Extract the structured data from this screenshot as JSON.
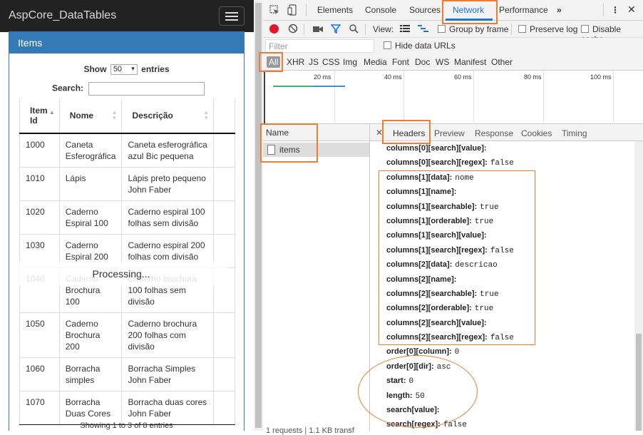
{
  "page": {
    "brand": "AspCore_DataTables",
    "panel_title": "Items",
    "length_prefix": "Show",
    "length_value": "50",
    "length_suffix": "entries",
    "search_label": "Search:",
    "columns": [
      {
        "line1": "Item",
        "line2": "Id"
      },
      {
        "line1": "Nome",
        "line2": ""
      },
      {
        "line1": "Descrição",
        "line2": ""
      }
    ],
    "rows": [
      {
        "id": "1000",
        "nome": "Caneta Esferográfica",
        "desc": "Caneta esferográfica azul Bic pequena"
      },
      {
        "id": "1010",
        "nome": "Lápis",
        "desc": "Lápis preto pequeno John Faber"
      },
      {
        "id": "1020",
        "nome": "Caderno Espiral 100",
        "desc": "Caderno espiral 100 folhas sem divisão"
      },
      {
        "id": "1030",
        "nome": "Caderno Espiral 200",
        "desc": "Caderno espiral 200 folhas com divisão"
      },
      {
        "id": "1040",
        "nome": "Caderno Brochura 100",
        "desc": "Caderno brochura 100 folhas sem divisão"
      },
      {
        "id": "1050",
        "nome": "Caderno Brochura 200",
        "desc": "Caderno brochura 200 folhas com divisão"
      },
      {
        "id": "1060",
        "nome": "Borracha simples",
        "desc": "Borracha Simples John Faber"
      },
      {
        "id": "1070",
        "nome": "Borracha Duas Cores",
        "desc": "Borracha duas cores John Faber"
      }
    ],
    "processing": "Processing...",
    "info": "Showing 1 to 3 of 8 entries"
  },
  "devtools": {
    "panels": [
      "Elements",
      "Console",
      "Sources",
      "Network",
      "Performance",
      "»"
    ],
    "active_panel": "Network",
    "toolbar": {
      "view_label": "View:",
      "group_by_frame": "Group by frame",
      "preserve_log": "Preserve log",
      "disable_cache": "Disable cache"
    },
    "filter_placeholder": "Filter",
    "hide_data_urls": "Hide data URLs",
    "types": [
      "All",
      "XHR",
      "JS",
      "CSS",
      "Img",
      "Media",
      "Font",
      "Doc",
      "WS",
      "Manifest",
      "Other"
    ],
    "timeline_ticks": [
      "20 ms",
      "40 ms",
      "60 ms",
      "80 ms",
      "100 ms"
    ],
    "name_header": "Name",
    "request_name": "items",
    "summary": "1 requests | 1.1 KB transf",
    "detail_tabs": [
      "Headers",
      "Preview",
      "Response",
      "Cookies",
      "Timing"
    ],
    "form_data": [
      {
        "k": "columns[0][search][value]:",
        "v": ""
      },
      {
        "k": "columns[0][search][regex]:",
        "v": "false"
      },
      {
        "k": "columns[1][data]:",
        "v": "nome"
      },
      {
        "k": "columns[1][name]:",
        "v": ""
      },
      {
        "k": "columns[1][searchable]:",
        "v": "true"
      },
      {
        "k": "columns[1][orderable]:",
        "v": "true"
      },
      {
        "k": "columns[1][search][value]:",
        "v": ""
      },
      {
        "k": "columns[1][search][regex]:",
        "v": "false"
      },
      {
        "k": "columns[2][data]:",
        "v": "descricao"
      },
      {
        "k": "columns[2][name]:",
        "v": ""
      },
      {
        "k": "columns[2][searchable]:",
        "v": "true"
      },
      {
        "k": "columns[2][orderable]:",
        "v": "true"
      },
      {
        "k": "columns[2][search][value]:",
        "v": ""
      },
      {
        "k": "columns[2][search][regex]:",
        "v": "false"
      },
      {
        "k": "order[0][column]:",
        "v": "0"
      },
      {
        "k": "order[0][dir]:",
        "v": "asc"
      },
      {
        "k": "start:",
        "v": "0"
      },
      {
        "k": "length:",
        "v": "50"
      },
      {
        "k": "search[value]:",
        "v": ""
      },
      {
        "k": "search[regex]:",
        "v": "false"
      }
    ]
  },
  "colors": {
    "accent": "#ed7d31",
    "panel_blue": "#337ab7",
    "navbar": "#222222",
    "devtools_active": "#1a73e8",
    "record_red": "#e0182a"
  }
}
